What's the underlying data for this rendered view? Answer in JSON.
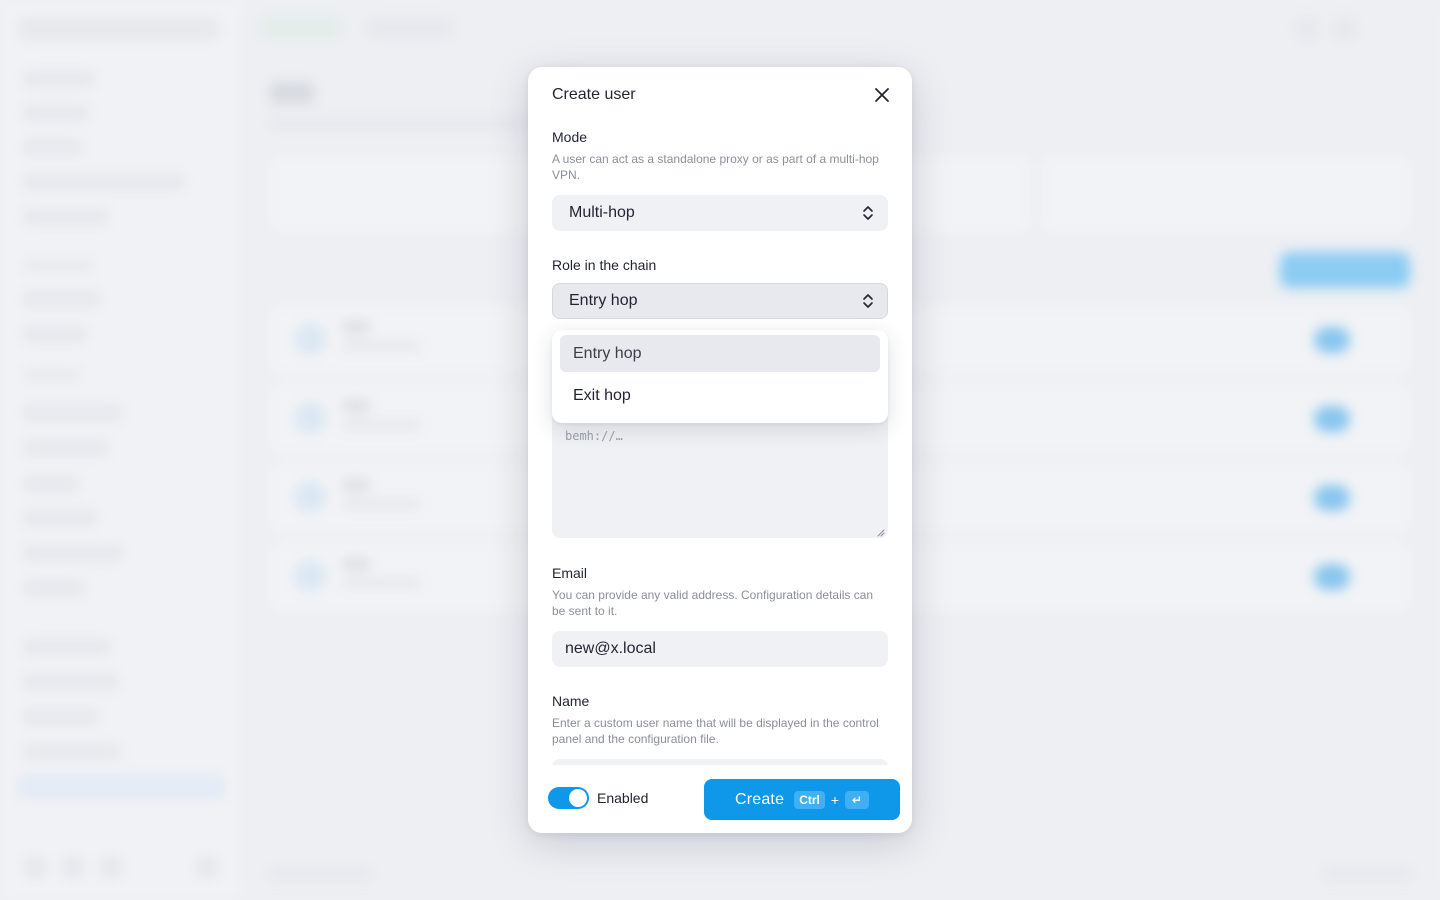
{
  "modal": {
    "title": "Create user",
    "mode": {
      "label": "Mode",
      "help": "A user can act as a standalone proxy or as part of a multi-hop VPN.",
      "value": "Multi-hop"
    },
    "role": {
      "label": "Role in the chain",
      "value": "Entry hop",
      "options": [
        "Entry hop",
        "Exit hop"
      ],
      "highlighted": "Entry hop"
    },
    "link": {
      "placeholder": "bemh://…"
    },
    "email": {
      "label": "Email",
      "help": "You can provide any valid address. Configuration details can be sent to it.",
      "value": "new@x.local"
    },
    "name": {
      "label": "Name",
      "help": "Enter a custom user name that will be displayed in the control panel and the configuration file."
    },
    "footer": {
      "toggle_label": "Enabled",
      "toggle_on": true,
      "create_label": "Create",
      "shortcut_key": "Ctrl",
      "shortcut_plus": "+",
      "shortcut_enter": "↵"
    }
  },
  "colors": {
    "accent": "#0f97ea",
    "field_bg": "#f0f1f5",
    "muted_text": "#8a8f9a"
  },
  "icons": {
    "close": "close-icon",
    "select_chevron": "chevron-up-down-icon",
    "resize": "resize-grip-icon"
  }
}
